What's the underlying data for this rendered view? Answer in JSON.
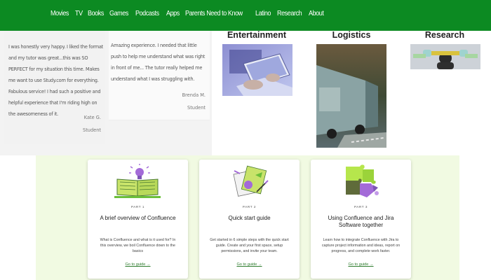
{
  "nav": {
    "items": [
      "Movies",
      "TV",
      "Books",
      "Games",
      "Podcasts",
      "Apps",
      "Parents Need to Know",
      "Latino",
      "Research",
      "About"
    ]
  },
  "testimonials": [
    {
      "quote": "I was honestly very happy. I liked the format and my tutor was great...this was SO PERFECT for my situation this time. Makes me want to use Study.com for everything. Fabulous service! I had such a positive and helpful experience that I'm riding high on the awesomeness of it.",
      "name": "Kate G.",
      "role": "Student"
    },
    {
      "quote": "Amazing experience. I needed that little push to help me understand what was right in front of me... The tutor really helped me understand what I was struggling with.",
      "name": "Brenda M.",
      "role": "Student"
    }
  ],
  "categories": [
    {
      "title": "Entertainment",
      "image": "laptop-hands-photo"
    },
    {
      "title": "Logistics",
      "image": "truck-photo"
    },
    {
      "title": "Research",
      "image": "person-with-ruler-photo"
    }
  ],
  "guides": [
    {
      "part": "PART 1",
      "title": "A brief overview of Confluence",
      "desc": "What is Confluence and what is it used for? In this overview, we boil Confluence down to the basics",
      "link": "Go to guide →",
      "illustration": "book-lightbulb-icon"
    },
    {
      "part": "PART 2",
      "title": "Quick start guide",
      "desc": "Get started in 6 simple steps with the quick start guide. Create and your first space, setup permissions, and invite your team.",
      "link": "Go to guide →",
      "illustration": "documents-pen-icon"
    },
    {
      "part": "PART 3",
      "title": "Using Confluence and Jira Software together",
      "desc": "Learn how to integrate Confluence with Jira to capture project information and ideas, report on progress, and complete work faster.",
      "link": "Go to guide →",
      "illustration": "puzzle-pieces-icon"
    }
  ],
  "colors": {
    "nav_bg": "#0c8a22",
    "guide_bg": "#f1fae2",
    "link": "#2f7d2f"
  }
}
